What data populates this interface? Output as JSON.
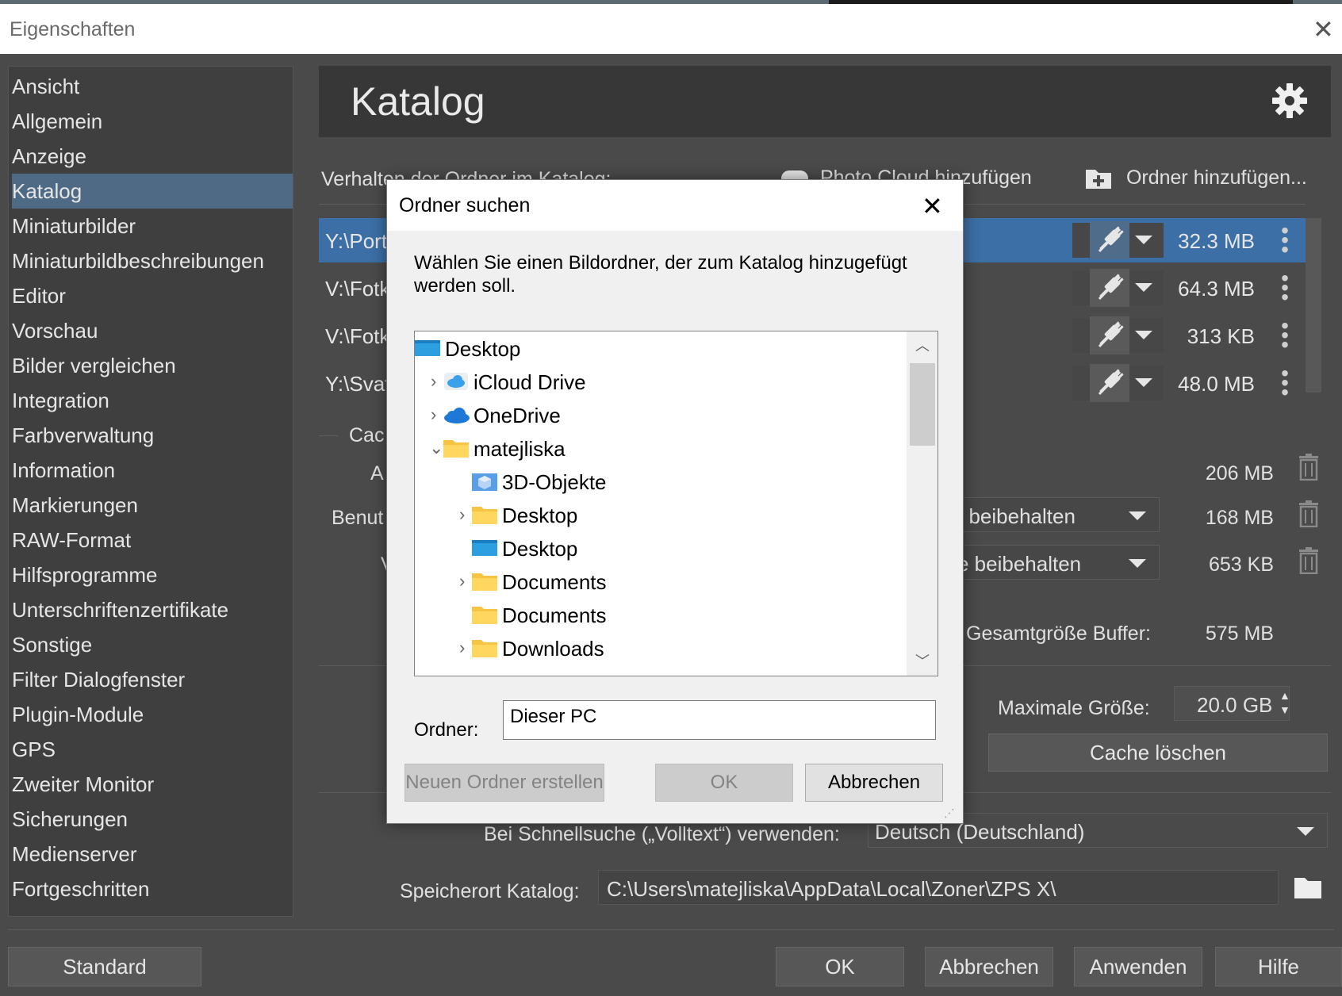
{
  "window": {
    "title": "Eigenschaften"
  },
  "sidebar": {
    "items": [
      {
        "label": "Ansicht"
      },
      {
        "label": "Allgemein"
      },
      {
        "label": "Anzeige"
      },
      {
        "label": "Katalog",
        "active": true
      },
      {
        "label": "Miniaturbilder"
      },
      {
        "label": "Miniaturbildbeschreibungen"
      },
      {
        "label": "Editor"
      },
      {
        "label": "Vorschau"
      },
      {
        "label": "Bilder vergleichen"
      },
      {
        "label": "Integration"
      },
      {
        "label": "Farbverwaltung"
      },
      {
        "label": "Information"
      },
      {
        "label": "Markierungen"
      },
      {
        "label": "RAW-Format"
      },
      {
        "label": "Hilfsprogramme"
      },
      {
        "label": "Unterschriftenzertifikate"
      },
      {
        "label": "Sonstige"
      },
      {
        "label": "Filter Dialogfenster"
      },
      {
        "label": "Plugin-Module"
      },
      {
        "label": "GPS"
      },
      {
        "label": "Zweiter Monitor"
      },
      {
        "label": "Sicherungen"
      },
      {
        "label": "Medienserver"
      },
      {
        "label": "Fortgeschritten"
      }
    ]
  },
  "page": {
    "title": "Katalog",
    "folders_label": "Verhalten der Ordner im Katalog:",
    "photo_cloud_label": "Photo Cloud hinzufügen",
    "add_folder_label": "Ordner hinzufügen...",
    "folders": [
      {
        "path": "Y:\\Port",
        "size": "32.3 MB",
        "selected": true
      },
      {
        "path": "V:\\Fotk",
        "size": "64.3 MB"
      },
      {
        "path": "V:\\Fotk",
        "size": "313 KB"
      },
      {
        "path": "Y:\\Svat",
        "size": "48.0 MB"
      }
    ],
    "cache": {
      "section_label": "Cac",
      "row1_label": "A",
      "row1_size": "206 MB",
      "row2_label": "Benut",
      "row2_combo": "t beibehalten",
      "row2_size": "168 MB",
      "row3_label": "V",
      "row3_combo": "e beibehalten",
      "row3_size": "653 KB",
      "total_label": "Gesamtgröße Buffer:",
      "total_size": "575 MB",
      "max_label": "Maximale Größe:",
      "max_value": "20.0 GB",
      "clear_button": "Cache löschen"
    },
    "quicksearch_label": "Bei Schnellsuche („Volltext“) verwenden:",
    "quicksearch_value": "Deutsch (Deutschland)",
    "catalog_location_label": "Speicherort Katalog:",
    "catalog_location_value": "C:\\Users\\matejliska\\AppData\\Local\\Zoner\\ZPS X\\"
  },
  "footer": {
    "standard": "Standard",
    "ok": "OK",
    "cancel": "Abbrechen",
    "apply": "Anwenden",
    "help": "Hilfe"
  },
  "dialog": {
    "title": "Ordner suchen",
    "description": "Wählen Sie einen Bildordner, der zum Katalog hinzugefügt werden soll.",
    "tree": [
      {
        "label": "Desktop",
        "icon": "desktop-icon",
        "level": 0,
        "chevron": ""
      },
      {
        "label": "iCloud Drive",
        "icon": "icloud-icon",
        "level": 1,
        "chevron": "collapsed"
      },
      {
        "label": "OneDrive",
        "icon": "onedrive-icon",
        "level": 1,
        "chevron": "collapsed"
      },
      {
        "label": "matejliska",
        "icon": "folder-icon",
        "level": 1,
        "chevron": "expanded"
      },
      {
        "label": "3D-Objekte",
        "icon": "3d-objects-icon",
        "level": 2,
        "chevron": ""
      },
      {
        "label": "Desktop",
        "icon": "folder-icon",
        "level": 2,
        "chevron": "collapsed"
      },
      {
        "label": "Desktop",
        "icon": "desktop-icon",
        "level": 2,
        "chevron": ""
      },
      {
        "label": "Documents",
        "icon": "folder-icon",
        "level": 2,
        "chevron": "collapsed"
      },
      {
        "label": "Documents",
        "icon": "folder-icon",
        "level": 2,
        "chevron": ""
      },
      {
        "label": "Downloads",
        "icon": "folder-icon",
        "level": 2,
        "chevron": "collapsed"
      }
    ],
    "folder_label": "Ordner:",
    "folder_value": "Dieser PC",
    "new_folder_button": "Neuen Ordner erstellen",
    "ok_button": "OK",
    "cancel_button": "Abbrechen"
  },
  "colors": {
    "accent": "#3c6fa5",
    "sidebar_active": "#4e6a85",
    "background": "#4a4a4a"
  }
}
